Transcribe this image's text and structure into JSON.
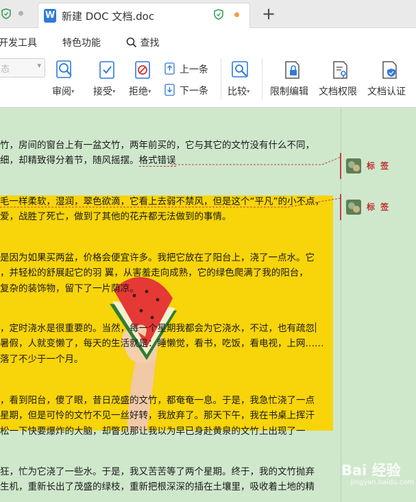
{
  "tabs": [
    {
      "label": ""
    },
    {
      "label": "新建 DOC 文档.doc",
      "icon_letter": "W"
    }
  ],
  "newtab_glyph": "+",
  "menu": {
    "items": [
      "开发工具",
      "特色功能"
    ],
    "search_label": "查找"
  },
  "toolbar": {
    "dropdown_value": "态",
    "review": "审阅",
    "accept": "接受",
    "reject": "拒绝",
    "prev": "上一条",
    "next": "下一条",
    "compare": "比较",
    "restrict_edit": "限制编辑",
    "doc_permission": "文档权限",
    "doc_cert": "文档认证"
  },
  "document": {
    "p1": [
      "竹，房间的窗台上有一盆文竹，两年前买的，它与其它的文竹没有什么不同，",
      "细，却精致得分着节，随风摇摆。"
    ],
    "p1_tag": "格式错误",
    "p2": [
      "毛一样柔软，湿润，翠色欲滴，它看上去弱不禁风，但是这个“平凡”的小不点，",
      "爱，战胜了死亡，做到了其他的花卉都无法做到的事情。"
    ],
    "p3": [
      "是因为如果买两盆，价格会便宜许多。我把它放在了阳台上，浇了一点水。它",
      "，并轻松的舒展起它的羽 翼，从害羞走向成熟，它的绿色爬满了我的阳台，",
      "复杂的装饰物，留下了一片荫凉。"
    ],
    "p4": [
      "，定时浇水是很重要的。当然，每一个星期我都会为它浇水，不过，也有疏忽",
      "暑假，人就变懒了，每天的生活就是：睡懒觉，看书，吃饭，看电视，上网……",
      "落了不少于一个月。"
    ],
    "p5": [
      "，看到阳台，傻了眼，昔日茂盛的文竹，都奄奄一息。于是，我急忙浇了一点",
      "星期，但是可怜的文竹不见一丝好转，我放弃了。那天下午，我在书桌上挥汗",
      "松一下快要爆炸的大脑，却瞥见那让我以为早已身赴黄泉的文竹上出现了一"
    ],
    "p6": [
      "狂，忙为它浇了一些水。于是，我又苦苦等了两个星期。终于，我的文竹抛弃",
      "生机，重新长出了茂盛的绿枝，重新把根深深的插在土壤里，吸收着土地的精"
    ]
  },
  "comments": [
    {
      "label": "标 签"
    },
    {
      "label": "标 签"
    }
  ],
  "watermark": {
    "text": "Bai 经验",
    "sub": "jingyan.baidu.com"
  },
  "colors": {
    "doc_bg": "#cfe8cc",
    "highlight": "#f8d40a",
    "accent_blue": "#2f7ad8",
    "comment_red": "#c03030"
  }
}
